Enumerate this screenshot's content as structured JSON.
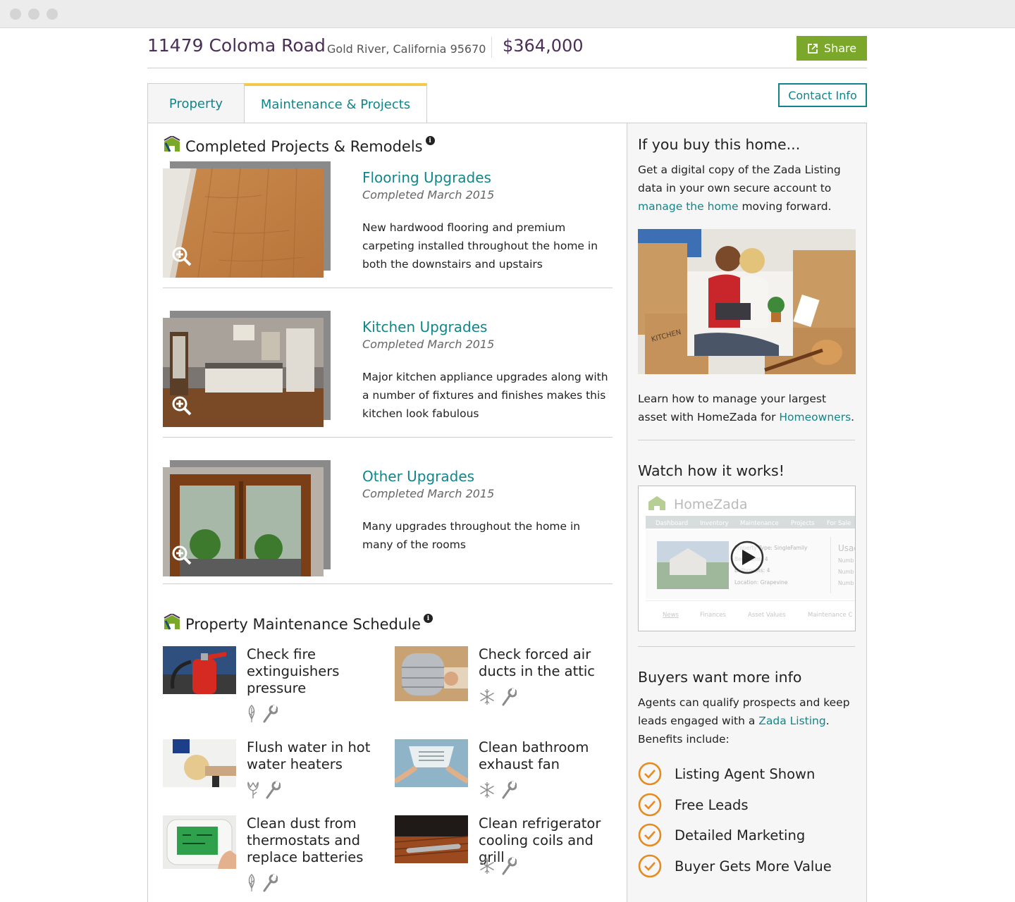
{
  "header": {
    "address": "11479 Coloma Road",
    "city_state_zip": "Gold River, California 95670",
    "price": "$364,000",
    "share_label": "Share",
    "contact_label": "Contact Info"
  },
  "tabs": [
    {
      "label": "Property",
      "active": false
    },
    {
      "label": "Maintenance & Projects",
      "active": true
    }
  ],
  "projects_section": {
    "title": "Completed Projects & Remodels",
    "info_glyph": "i",
    "items": [
      {
        "title": "Flooring Upgrades",
        "date": "Completed March 2015",
        "description": "New hardwood flooring and premium carpeting installed throughout the home in both the downstairs and upstairs",
        "image": "hardwood-floor-photo"
      },
      {
        "title": "Kitchen Upgrades",
        "date": "Completed March 2015",
        "description": "Major kitchen appliance upgrades along with a number of fixtures and finishes makes this kitchen look fabulous",
        "image": "kitchen-photo"
      },
      {
        "title": "Other Upgrades",
        "date": "Completed March 2015",
        "description": "Many upgrades throughout the home in many of the rooms",
        "image": "glass-doors-photo"
      }
    ]
  },
  "maintenance_section": {
    "title": "Property Maintenance Schedule",
    "info_glyph": "i",
    "tasks": [
      {
        "label": "Check fire extinguishers pressure",
        "season_icon": "leaf-icon",
        "image": "fire-extinguisher-photo"
      },
      {
        "label": "Check forced air ducts in the attic",
        "season_icon": "snowflake-icon",
        "image": "air-ducts-photo"
      },
      {
        "label": "Flush water in hot water heaters",
        "season_icon": "tulip-icon",
        "image": "water-heater-photo"
      },
      {
        "label": "Clean bathroom exhaust fan",
        "season_icon": "snowflake-icon",
        "image": "exhaust-fan-photo"
      },
      {
        "label": "Clean dust from thermostats and replace batteries",
        "season_icon": "leaf-icon",
        "image": "thermostat-photo"
      },
      {
        "label": "Clean refrigerator cooling coils and grill",
        "season_icon": "snowflake-icon",
        "image": "refrigerator-coils-photo"
      }
    ]
  },
  "sidebar": {
    "buy": {
      "title": "If you buy this home...",
      "text_before": "Get a digital copy of the Zada Listing data in your own secure account to ",
      "link": "manage the home",
      "text_after": " moving forward."
    },
    "learn": {
      "text_before": "Learn how to manage your largest asset with HomeZada for ",
      "link": "Homeowners",
      "text_after": "."
    },
    "video": {
      "title": "Watch how it works!",
      "brand": "HomeZada",
      "nav": [
        "Dashboard",
        "Inventory",
        "Maintenance",
        "Projects",
        "For Sale"
      ],
      "fields": [
        "Property Type: SingleFamily",
        "Bedrooms: 4",
        "Bathrooms: 4",
        "Location: Grapevine"
      ],
      "usage_title": "Usag",
      "usage_rows": [
        "Numb",
        "Numb",
        "Numb"
      ],
      "bottom_tabs": [
        "News",
        "Finances",
        "Asset Values",
        "Maintenance C"
      ]
    },
    "buyers": {
      "title": "Buyers want more info",
      "text_before": "Agents can qualify prospects and keep leads engaged with a ",
      "link": "Zada Listing",
      "text_after": ". Benefits include:",
      "benefits": [
        "Listing Agent Shown",
        "Free Leads",
        "Detailed Marketing",
        "Buyer Gets More Value"
      ]
    }
  },
  "colors": {
    "brand_purple": "#4b2e58",
    "link_teal": "#12858a",
    "share_green": "#7ba72a",
    "tab_accent_yellow": "#f2c94c",
    "check_orange": "#e58b1f"
  }
}
